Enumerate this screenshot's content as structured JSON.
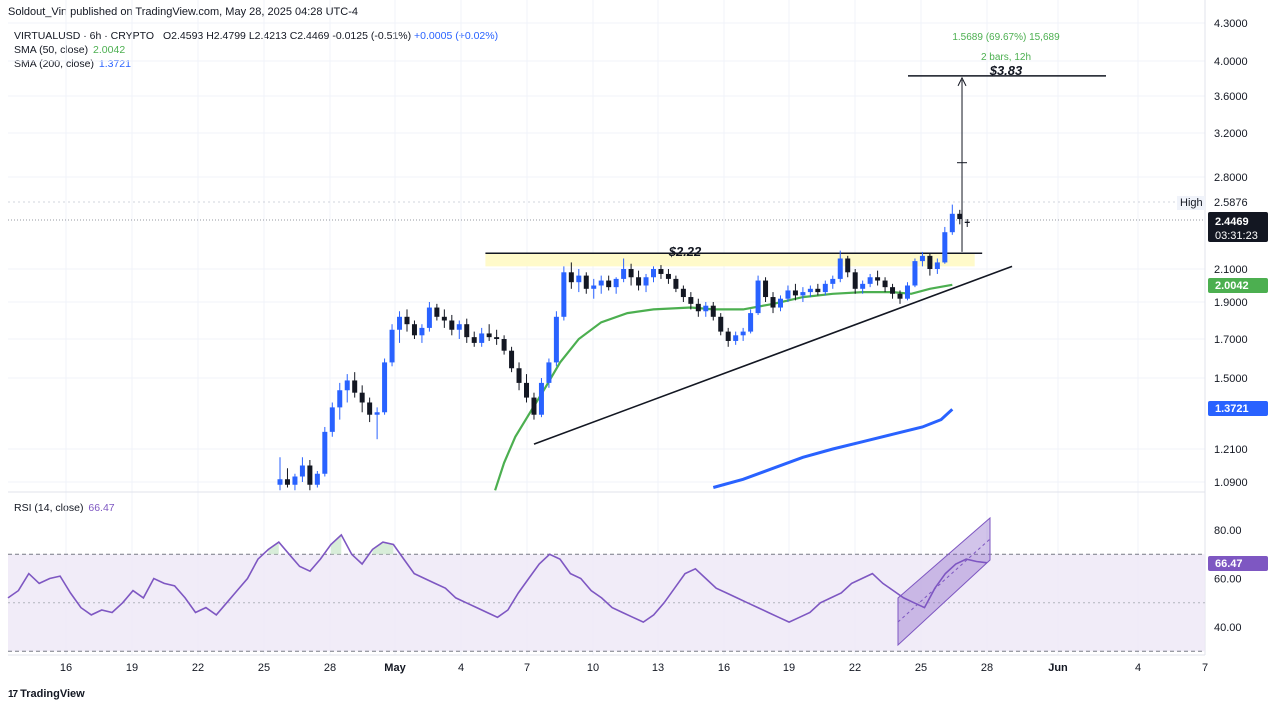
{
  "header": {
    "publish_line": "Soldout_Vin published on TradingView.com, May 28, 2025 04:28 UTC-4"
  },
  "legend": {
    "symbol_line": "VIRTUALUSD · 6h · CRYPTO",
    "ohlc": {
      "o": "O2.4593",
      "h": "H2.4799",
      "l": "L2.4213",
      "c": "C2.4469"
    },
    "change": "-0.0125 (-0.51%)",
    "extra_change": "+0.0005 (+0.02%)",
    "sma50_label": "SMA (50, close)",
    "sma50_value": "2.0042",
    "sma200_label": "SMA (200, close)",
    "sma200_value": "1.3721",
    "rsi_label": "RSI (14, close)",
    "rsi_value": "66.47"
  },
  "colors": {
    "up": "#2962ff",
    "down": "#131722",
    "sma50": "#4caf50",
    "sma200": "#2962ff",
    "rsi_line": "#7e57c2",
    "zone": "#fff9c4",
    "rsi_band": "#ede7f6"
  },
  "annotations": {
    "resistance_label": "$2.22",
    "target_label": "$3.83",
    "measure_line1": "1.5689 (69.67%) 15,689",
    "measure_line2": "2 bars, 12h",
    "high_label": "High",
    "high_value": "2.5876",
    "last_price": "2.4469",
    "countdown": "03:31:23",
    "sma50_tag": "2.0042",
    "sma200_tag": "1.3721",
    "rsi_tag": "66.47"
  },
  "footer": {
    "brand": "TradingView",
    "logo_glyph": "17"
  },
  "chart_data": [
    {
      "type": "candlestick",
      "title": "VIRTUALUSD · 6h · CRYPTO",
      "price_axis_ticks": [
        "4.3000",
        "4.0000",
        "3.6000",
        "3.2000",
        "2.8000",
        "2.1000",
        "1.9000",
        "1.7000",
        "1.5000",
        "1.2100",
        "1.0900"
      ],
      "x_tick_labels": [
        "16",
        "19",
        "22",
        "25",
        "28",
        "May",
        "4",
        "7",
        "10",
        "13",
        "16",
        "19",
        "22",
        "25",
        "28",
        "Jun",
        "4",
        "7"
      ],
      "candles": [
        {
          "o": 1.08,
          "h": 1.18,
          "l": 1.06,
          "c": 1.1
        },
        {
          "o": 1.1,
          "h": 1.14,
          "l": 1.07,
          "c": 1.08
        },
        {
          "o": 1.08,
          "h": 1.12,
          "l": 1.06,
          "c": 1.11
        },
        {
          "o": 1.11,
          "h": 1.18,
          "l": 1.09,
          "c": 1.15
        },
        {
          "o": 1.15,
          "h": 1.17,
          "l": 1.06,
          "c": 1.08
        },
        {
          "o": 1.08,
          "h": 1.13,
          "l": 1.07,
          "c": 1.12
        },
        {
          "o": 1.12,
          "h": 1.3,
          "l": 1.11,
          "c": 1.28
        },
        {
          "o": 1.28,
          "h": 1.4,
          "l": 1.26,
          "c": 1.38
        },
        {
          "o": 1.38,
          "h": 1.48,
          "l": 1.33,
          "c": 1.45
        },
        {
          "o": 1.45,
          "h": 1.52,
          "l": 1.4,
          "c": 1.49
        },
        {
          "o": 1.49,
          "h": 1.53,
          "l": 1.42,
          "c": 1.44
        },
        {
          "o": 1.44,
          "h": 1.47,
          "l": 1.36,
          "c": 1.4
        },
        {
          "o": 1.4,
          "h": 1.42,
          "l": 1.32,
          "c": 1.35
        },
        {
          "o": 1.35,
          "h": 1.38,
          "l": 1.25,
          "c": 1.36
        },
        {
          "o": 1.36,
          "h": 1.6,
          "l": 1.35,
          "c": 1.58
        },
        {
          "o": 1.58,
          "h": 1.78,
          "l": 1.56,
          "c": 1.75
        },
        {
          "o": 1.75,
          "h": 1.85,
          "l": 1.68,
          "c": 1.82
        },
        {
          "o": 1.82,
          "h": 1.86,
          "l": 1.74,
          "c": 1.78
        },
        {
          "o": 1.78,
          "h": 1.8,
          "l": 1.7,
          "c": 1.72
        },
        {
          "o": 1.72,
          "h": 1.78,
          "l": 1.68,
          "c": 1.76
        },
        {
          "o": 1.76,
          "h": 1.9,
          "l": 1.74,
          "c": 1.87
        },
        {
          "o": 1.87,
          "h": 1.89,
          "l": 1.8,
          "c": 1.82
        },
        {
          "o": 1.82,
          "h": 1.86,
          "l": 1.76,
          "c": 1.8
        },
        {
          "o": 1.8,
          "h": 1.83,
          "l": 1.72,
          "c": 1.75
        },
        {
          "o": 1.75,
          "h": 1.8,
          "l": 1.7,
          "c": 1.78
        },
        {
          "o": 1.78,
          "h": 1.81,
          "l": 1.68,
          "c": 1.71
        },
        {
          "o": 1.71,
          "h": 1.74,
          "l": 1.66,
          "c": 1.68
        },
        {
          "o": 1.68,
          "h": 1.76,
          "l": 1.66,
          "c": 1.73
        },
        {
          "o": 1.73,
          "h": 1.78,
          "l": 1.69,
          "c": 1.71
        },
        {
          "o": 1.71,
          "h": 1.75,
          "l": 1.67,
          "c": 1.7
        },
        {
          "o": 1.7,
          "h": 1.72,
          "l": 1.62,
          "c": 1.64
        },
        {
          "o": 1.64,
          "h": 1.66,
          "l": 1.53,
          "c": 1.55
        },
        {
          "o": 1.55,
          "h": 1.58,
          "l": 1.45,
          "c": 1.48
        },
        {
          "o": 1.48,
          "h": 1.52,
          "l": 1.4,
          "c": 1.42
        },
        {
          "o": 1.42,
          "h": 1.44,
          "l": 1.33,
          "c": 1.35
        },
        {
          "o": 1.35,
          "h": 1.5,
          "l": 1.34,
          "c": 1.48
        },
        {
          "o": 1.48,
          "h": 1.6,
          "l": 1.46,
          "c": 1.58
        },
        {
          "o": 1.58,
          "h": 1.85,
          "l": 1.56,
          "c": 1.82
        },
        {
          "o": 1.82,
          "h": 2.12,
          "l": 1.8,
          "c": 2.08
        },
        {
          "o": 2.08,
          "h": 2.15,
          "l": 1.98,
          "c": 2.02
        },
        {
          "o": 2.02,
          "h": 2.1,
          "l": 1.96,
          "c": 2.06
        },
        {
          "o": 2.06,
          "h": 2.08,
          "l": 1.95,
          "c": 1.98
        },
        {
          "o": 1.98,
          "h": 2.04,
          "l": 1.92,
          "c": 2.0
        },
        {
          "o": 2.0,
          "h": 2.06,
          "l": 1.95,
          "c": 2.03
        },
        {
          "o": 2.03,
          "h": 2.06,
          "l": 1.97,
          "c": 1.99
        },
        {
          "o": 1.99,
          "h": 2.05,
          "l": 1.95,
          "c": 2.04
        },
        {
          "o": 2.04,
          "h": 2.18,
          "l": 2.02,
          "c": 2.1
        },
        {
          "o": 2.1,
          "h": 2.14,
          "l": 2.0,
          "c": 2.05
        },
        {
          "o": 2.05,
          "h": 2.09,
          "l": 1.97,
          "c": 2.0
        },
        {
          "o": 2.0,
          "h": 2.07,
          "l": 1.96,
          "c": 2.05
        },
        {
          "o": 2.05,
          "h": 2.12,
          "l": 2.02,
          "c": 2.1
        },
        {
          "o": 2.1,
          "h": 2.13,
          "l": 2.04,
          "c": 2.07
        },
        {
          "o": 2.07,
          "h": 2.1,
          "l": 2.01,
          "c": 2.04
        },
        {
          "o": 2.04,
          "h": 2.06,
          "l": 1.96,
          "c": 1.98
        },
        {
          "o": 1.98,
          "h": 2.0,
          "l": 1.9,
          "c": 1.93
        },
        {
          "o": 1.93,
          "h": 1.96,
          "l": 1.86,
          "c": 1.89
        },
        {
          "o": 1.89,
          "h": 1.92,
          "l": 1.82,
          "c": 1.85
        },
        {
          "o": 1.85,
          "h": 1.9,
          "l": 1.82,
          "c": 1.88
        },
        {
          "o": 1.88,
          "h": 1.9,
          "l": 1.8,
          "c": 1.82
        },
        {
          "o": 1.82,
          "h": 1.84,
          "l": 1.72,
          "c": 1.74
        },
        {
          "o": 1.74,
          "h": 1.76,
          "l": 1.66,
          "c": 1.69
        },
        {
          "o": 1.69,
          "h": 1.74,
          "l": 1.67,
          "c": 1.72
        },
        {
          "o": 1.72,
          "h": 1.76,
          "l": 1.69,
          "c": 1.74
        },
        {
          "o": 1.74,
          "h": 1.86,
          "l": 1.73,
          "c": 1.84
        },
        {
          "o": 1.84,
          "h": 2.06,
          "l": 1.83,
          "c": 2.03
        },
        {
          "o": 2.03,
          "h": 2.05,
          "l": 1.9,
          "c": 1.93
        },
        {
          "o": 1.93,
          "h": 1.96,
          "l": 1.84,
          "c": 1.87
        },
        {
          "o": 1.87,
          "h": 1.94,
          "l": 1.85,
          "c": 1.92
        },
        {
          "o": 1.92,
          "h": 2.0,
          "l": 1.9,
          "c": 1.97
        },
        {
          "o": 1.97,
          "h": 2.01,
          "l": 1.91,
          "c": 1.94
        },
        {
          "o": 1.94,
          "h": 1.99,
          "l": 1.9,
          "c": 1.96
        },
        {
          "o": 1.96,
          "h": 2.0,
          "l": 1.93,
          "c": 1.98
        },
        {
          "o": 1.98,
          "h": 2.01,
          "l": 1.94,
          "c": 1.96
        },
        {
          "o": 1.96,
          "h": 2.03,
          "l": 1.94,
          "c": 2.01
        },
        {
          "o": 2.01,
          "h": 2.06,
          "l": 1.98,
          "c": 2.04
        },
        {
          "o": 2.04,
          "h": 2.24,
          "l": 2.02,
          "c": 2.18
        },
        {
          "o": 2.18,
          "h": 2.2,
          "l": 2.05,
          "c": 2.08
        },
        {
          "o": 2.08,
          "h": 2.1,
          "l": 1.95,
          "c": 1.98
        },
        {
          "o": 1.98,
          "h": 2.03,
          "l": 1.95,
          "c": 2.01
        },
        {
          "o": 2.01,
          "h": 2.07,
          "l": 1.99,
          "c": 2.05
        },
        {
          "o": 2.05,
          "h": 2.09,
          "l": 2.0,
          "c": 2.03
        },
        {
          "o": 2.03,
          "h": 2.05,
          "l": 1.96,
          "c": 1.99
        },
        {
          "o": 1.99,
          "h": 2.01,
          "l": 1.92,
          "c": 1.95
        },
        {
          "o": 1.95,
          "h": 1.97,
          "l": 1.89,
          "c": 1.92
        },
        {
          "o": 1.92,
          "h": 2.02,
          "l": 1.91,
          "c": 2.0
        },
        {
          "o": 2.0,
          "h": 2.18,
          "l": 1.99,
          "c": 2.16
        },
        {
          "o": 2.16,
          "h": 2.23,
          "l": 2.12,
          "c": 2.2
        },
        {
          "o": 2.2,
          "h": 2.22,
          "l": 2.06,
          "c": 2.1
        },
        {
          "o": 2.1,
          "h": 2.18,
          "l": 2.07,
          "c": 2.15
        },
        {
          "o": 2.15,
          "h": 2.42,
          "l": 2.14,
          "c": 2.38
        },
        {
          "o": 2.38,
          "h": 2.59,
          "l": 2.36,
          "c": 2.52
        },
        {
          "o": 2.52,
          "h": 2.55,
          "l": 2.44,
          "c": 2.48
        },
        {
          "o": 2.46,
          "h": 2.48,
          "l": 2.42,
          "c": 2.45
        }
      ],
      "sma50": {
        "name": "SMA (50, close)",
        "points": [
          [
            28.8,
            1.06
          ],
          [
            30.0,
            1.16
          ],
          [
            31.5,
            1.26
          ],
          [
            33.5,
            1.36
          ],
          [
            35.5,
            1.46
          ],
          [
            37.5,
            1.58
          ],
          [
            40.0,
            1.7
          ],
          [
            43.0,
            1.79
          ],
          [
            46.5,
            1.84
          ],
          [
            50.0,
            1.86
          ],
          [
            55.0,
            1.87
          ],
          [
            58.0,
            1.86
          ],
          [
            62.0,
            1.86
          ],
          [
            66.0,
            1.89
          ],
          [
            70.0,
            1.93
          ],
          [
            74.0,
            1.95
          ],
          [
            78.0,
            1.96
          ],
          [
            82.0,
            1.96
          ],
          [
            84.5,
            1.95
          ],
          [
            87.0,
            1.98
          ],
          [
            90.0,
            2.004
          ]
        ]
      },
      "sma200": {
        "name": "SMA (200, close)",
        "points": [
          [
            58.0,
            1.07
          ],
          [
            62.0,
            1.1
          ],
          [
            66.0,
            1.14
          ],
          [
            70.0,
            1.18
          ],
          [
            74.0,
            1.21
          ],
          [
            78.0,
            1.24
          ],
          [
            82.0,
            1.27
          ],
          [
            86.0,
            1.3
          ],
          [
            88.5,
            1.33
          ],
          [
            90.0,
            1.372
          ]
        ]
      },
      "resistance": {
        "value": 2.22,
        "label": "$2.22",
        "from_bar": 27.5,
        "to_bar": 94.0
      },
      "zone": {
        "low": 2.12,
        "high": 2.22,
        "from_bar": 27.5,
        "to_bar": 93.0
      },
      "trendline": [
        [
          34.0,
          1.23
        ],
        [
          98.0,
          2.12
        ]
      ],
      "target": {
        "value": 3.83,
        "label": "$3.83",
        "at_bar": 91.3,
        "from_value": 2.23
      },
      "high": 2.5876,
      "last": 2.4469
    },
    {
      "type": "line",
      "title": "RSI (14, close)",
      "y_ticks": [
        "80.00",
        "60.00",
        "40.00"
      ],
      "upper_band": 70,
      "lower_band": 30,
      "mid": 50,
      "values": [
        52,
        55,
        62,
        58,
        60,
        61,
        54,
        48,
        45,
        47,
        46,
        50,
        55,
        52,
        60,
        58,
        57,
        52,
        46,
        48,
        45,
        50,
        55,
        60,
        68,
        72,
        75,
        70,
        65,
        63,
        68,
        74,
        78,
        70,
        66,
        72,
        75,
        74,
        68,
        62,
        60,
        58,
        56,
        52,
        50,
        48,
        46,
        44,
        47,
        54,
        60,
        66,
        70,
        68,
        62,
        60,
        55,
        52,
        48,
        46,
        44,
        42,
        45,
        50,
        56,
        62,
        64,
        60,
        56,
        54,
        52,
        50,
        48,
        46,
        44,
        42,
        44,
        46,
        50,
        52,
        54,
        58,
        60,
        62,
        58,
        55,
        52,
        50,
        48,
        56,
        62,
        66,
        68,
        67,
        66.47
      ]
    }
  ]
}
